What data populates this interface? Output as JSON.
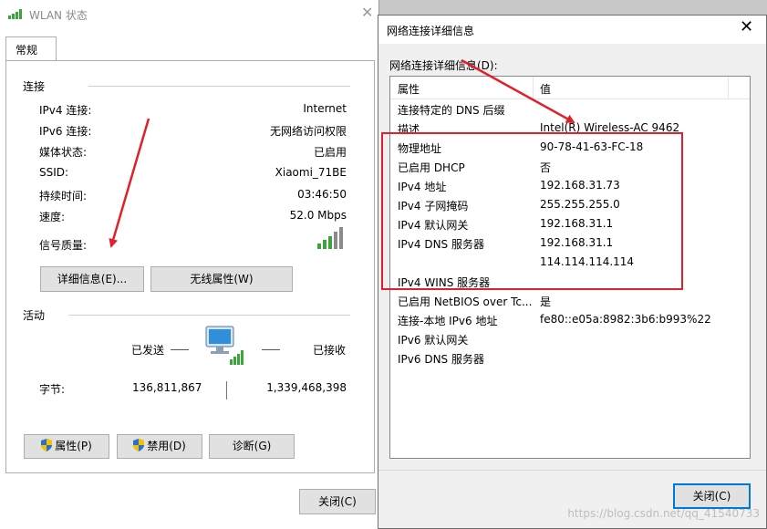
{
  "wlan_window": {
    "title": "WLAN 状态",
    "tab": "常规",
    "connection_group": "连接",
    "rows": [
      {
        "label": "IPv4 连接:",
        "value": "Internet"
      },
      {
        "label": "IPv6 连接:",
        "value": "无网络访问权限"
      },
      {
        "label": "媒体状态:",
        "value": "已启用"
      },
      {
        "label": "SSID:",
        "value": "Xiaomi_71BE"
      },
      {
        "label": "持续时间:",
        "value": "03:46:50"
      },
      {
        "label": "速度:",
        "value": "52.0 Mbps"
      }
    ],
    "signal_label": "信号质量:",
    "details_button": "详细信息(E)...",
    "wireless_button": "无线属性(W)",
    "activity_group": "活动",
    "sent_label": "已发送",
    "received_label": "已接收",
    "bytes_label": "字节:",
    "bytes_sent": "136,811,867",
    "bytes_received": "1,339,468,398",
    "properties_button": "属性(P)",
    "disable_button": "禁用(D)",
    "diagnose_button": "诊断(G)",
    "close_button": "关闭(C)"
  },
  "details_window": {
    "title": "网络连接详细信息",
    "list_label": "网络连接详细信息(D):",
    "header_property": "属性",
    "header_value": "值",
    "rows": [
      {
        "property": "连接特定的 DNS 后缀",
        "value": ""
      },
      {
        "property": "描述",
        "value": "Intel(R) Wireless-AC 9462"
      },
      {
        "property": "物理地址",
        "value": "90-78-41-63-FC-18"
      },
      {
        "property": "已启用 DHCP",
        "value": "否"
      },
      {
        "property": "IPv4 地址",
        "value": "192.168.31.73"
      },
      {
        "property": "IPv4 子网掩码",
        "value": "255.255.255.0"
      },
      {
        "property": "IPv4 默认网关",
        "value": "192.168.31.1"
      },
      {
        "property": "IPv4 DNS 服务器",
        "value": "192.168.31.1"
      },
      {
        "property": "",
        "value": "114.114.114.114"
      },
      {
        "property": "IPv4 WINS 服务器",
        "value": ""
      },
      {
        "property": "已启用 NetBIOS over Tc...",
        "value": "是"
      },
      {
        "property": "连接-本地 IPv6 地址",
        "value": "fe80::e05a:8982:3b6:b993%22"
      },
      {
        "property": "IPv6 默认网关",
        "value": ""
      },
      {
        "property": "IPv6 DNS 服务器",
        "value": ""
      }
    ],
    "close_button": "关闭(C)"
  },
  "watermark": "https://blog.csdn.net/qq_41540733",
  "colors": {
    "annotation_red": "#e0202a",
    "accent_blue": "#0078d7",
    "signal_green": "#3aa63a"
  }
}
